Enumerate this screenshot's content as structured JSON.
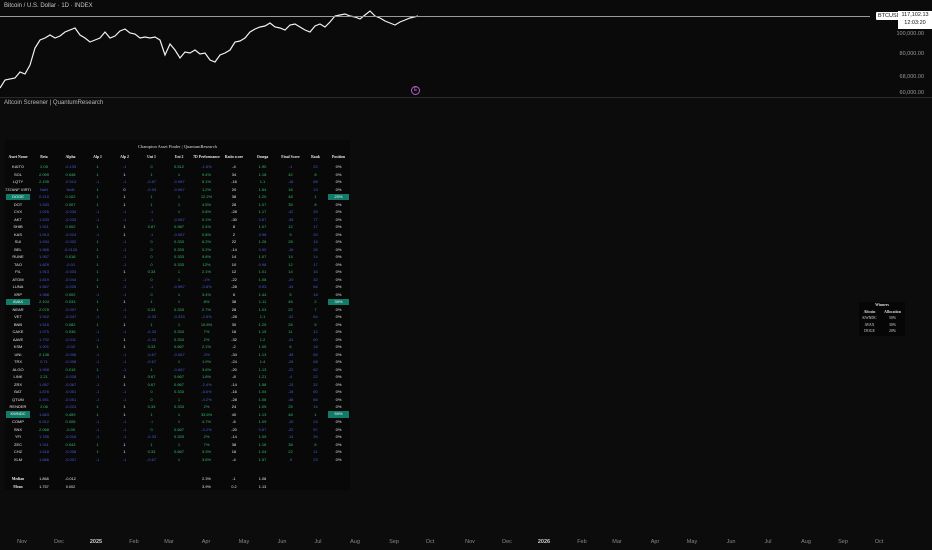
{
  "header": {
    "symbol_title": "Bitcoin / U.S. Dollar · 1D · INDEX"
  },
  "price_axis": {
    "symbol_tag": "BTCUSD",
    "last_price": "117,102.13",
    "countdown": "12:03:20",
    "labels": [
      "100,000.00",
      "80,000.00",
      "68,000.00",
      "60,000.00"
    ]
  },
  "marker": {
    "glyph": "E"
  },
  "indicator": {
    "title": "Altcoin Screener | QuantumResearch"
  },
  "table": {
    "title": "Champion Asset Finder | QuantumResearch",
    "headers": [
      "Asset Name",
      "Beta",
      "Alpha",
      "Alp 1",
      "Alp 2",
      "Uni 1",
      "Uni 2",
      "7D Performance",
      "Ratio score",
      "Omega",
      "Final Score",
      "Rank",
      "Position"
    ],
    "highlight_color": "#137a68",
    "rows": [
      [
        "KAITO",
        "2.08",
        "-0.133",
        "1",
        "-1",
        "0",
        "0.512",
        "-1.6%",
        "-4",
        "1.90",
        "-1",
        "22",
        "0%"
      ],
      [
        "SOL",
        "2.059",
        "0.048",
        "1",
        "1",
        "1",
        "1",
        "9.4%",
        "34",
        "1.18",
        "42",
        "8",
        "0%"
      ],
      [
        "LQTY",
        "2.195",
        "-0.513",
        "-1",
        "-1",
        "-0.87",
        "-0.987",
        "5.1%",
        "-16",
        "1.1",
        "-16",
        "88",
        "0%"
      ],
      [
        "737ANF VIRTU",
        "NaN",
        "NaN",
        "1",
        "0",
        "-0.93",
        "-0.967",
        "1.2%",
        "20",
        "1.64",
        "16",
        "13",
        "0%"
      ],
      [
        "DOGE",
        "0.119",
        "0.102",
        "1",
        "1",
        "1",
        "1",
        "12.2%",
        "38",
        "1.20",
        "48",
        "1",
        "20%"
      ],
      [
        "DOT",
        "1.933",
        "0.007",
        "1",
        "1",
        "1",
        "1",
        "4.5%",
        "28",
        "1.07",
        "35",
        "8",
        "0%"
      ],
      [
        "CVX",
        "1.925",
        "-0.034",
        "-1",
        "-1",
        "-1",
        "1",
        "0.8%",
        "-28",
        "1.17",
        "-42",
        "39",
        "0%"
      ],
      [
        "AKT",
        "1.533",
        "-0.033",
        "-1",
        "-1",
        "-1",
        "-0.987",
        "0.1%",
        "-30",
        "0.87",
        "-38",
        "77",
        "0%"
      ],
      [
        "SHIB",
        "1.511",
        "0.002",
        "1",
        "1",
        "0.87",
        "0.987",
        "2.4%",
        "8",
        "1.07",
        "12",
        "17",
        "0%"
      ],
      [
        "KAS",
        "1.913",
        "-0.024",
        "-1",
        "1",
        "-1",
        "-0.987",
        "0.8%",
        "2",
        "0.98",
        "9",
        "20",
        "0%"
      ],
      [
        "SUI",
        "1.934",
        "-0.002",
        "1",
        "-1",
        "0",
        "0.333",
        "6.2%",
        "22",
        "1.26",
        "28",
        "16",
        "0%"
      ],
      [
        "BEL",
        "1.966",
        "-0.0126",
        "1",
        "-1",
        "0",
        "0.333",
        "0.2%",
        "-14",
        "0.90",
        "-16",
        "26",
        "0%"
      ],
      [
        "RUNE",
        "1.957",
        "0.018",
        "1",
        "-1",
        "0",
        "0.333",
        "9.8%",
        "14",
        "1.07",
        "14",
        "14",
        "0%"
      ],
      [
        "TAO",
        "1.829",
        "-0.01",
        "1",
        "-1",
        "0",
        "0.333",
        "12%",
        "10",
        "0.98",
        "12",
        "17",
        "0%"
      ],
      [
        "FIL",
        "1.913",
        "-0.003",
        "1",
        "1",
        "0.33",
        "1",
        "2.1%",
        "12",
        "1.01",
        "14",
        "16",
        "0%"
      ],
      [
        "ATOM",
        "1.819",
        "-0.044",
        "1",
        "-1",
        "0",
        "1",
        "-1%",
        "-22",
        "1.08",
        "-20",
        "32",
        "0%"
      ],
      [
        "LUNA",
        "1.567",
        "-0.026",
        "1",
        "-1",
        "-1",
        "-0.987",
        "-0.8%",
        "-28",
        "0.93",
        "-34",
        "66",
        "0%"
      ],
      [
        "XRP",
        "1.988",
        "0.002",
        "-1",
        "-1",
        "0",
        "1",
        "3.4%",
        "6",
        "1.44",
        "5",
        "18",
        "0%"
      ],
      [
        "AVAX",
        "2.104",
        "0.033",
        "1",
        "1",
        "1",
        "1",
        "8%",
        "38",
        "1.11",
        "46",
        "2",
        "30%"
      ],
      [
        "NEAR",
        "2.078",
        "-0.007",
        "1",
        "-1",
        "0.33",
        "0.333",
        "2.7%",
        "28",
        "1.03",
        "22",
        "7",
        "0%"
      ],
      [
        "VET",
        "1.942",
        "-0.047",
        "-1",
        "-1",
        "-0.33",
        "-0.333",
        "-2.5%",
        "-28",
        "1.1",
        "-32",
        "84",
        "0%"
      ],
      [
        "BNB",
        "1.516",
        "0.082",
        "1",
        "1",
        "1",
        "1",
        "10.8%",
        "30",
        "1.25",
        "26",
        "5",
        "0%"
      ],
      [
        "CAKE",
        "1.975",
        "0.036",
        "-1",
        "-1",
        "-0.33",
        "0.333",
        "7%",
        "16",
        "1.15",
        "11",
        "12",
        "0%"
      ],
      [
        "AAVE",
        "1.792",
        "-0.011",
        "-1",
        "1",
        "-0.33",
        "0.333",
        "2%",
        "-32",
        "1.2",
        "-34",
        "60",
        "0%"
      ],
      [
        "KSM",
        "1.901",
        "-0.02",
        "1",
        "1",
        "0.33",
        "0.667",
        "2.1%",
        "-2",
        "1.05",
        "6",
        "18",
        "0%"
      ],
      [
        "UNI",
        "2.138",
        "-0.006",
        "-1",
        "-1",
        "-0.67",
        "-0.667",
        "-2%",
        "-34",
        "1.13",
        "-38",
        "65",
        "0%"
      ],
      [
        "TRX",
        "0.71",
        "-0.008",
        "-1",
        "-1",
        "-0.67",
        "1",
        "1.9%",
        "-24",
        "1.4",
        "-28",
        "68",
        "0%"
      ],
      [
        "ALGO",
        "1.998",
        "0.015",
        "1",
        "-1",
        "1",
        "-0.667",
        "3.6%",
        "-20",
        "1.13",
        "-22",
        "62",
        "0%"
      ],
      [
        "LINK",
        "2.21",
        "-0.028",
        "-1",
        "1",
        "0.67",
        "0.667",
        "1.8%",
        "-8",
        "1.21",
        "-4",
        "22",
        "0%"
      ],
      [
        "ZRX",
        "1.957",
        "-0.067",
        "-1",
        "1",
        "0.67",
        "0.667",
        "-2.4%",
        "-14",
        "1.58",
        "-13",
        "32",
        "0%"
      ],
      [
        "BAT",
        "1.876",
        "-0.051",
        "-1",
        "-1",
        "0",
        "0.333",
        "-5.6%",
        "-16",
        "1.04",
        "-18",
        "60",
        "0%"
      ],
      [
        "QTUM",
        "0.451",
        "-0.051",
        "-1",
        "-1",
        "0",
        "1",
        "-4.2%",
        "-28",
        "1.06",
        "-48",
        "66",
        "0%"
      ],
      [
        "RENDER",
        "2.06",
        "-0.024",
        "1",
        "1",
        "0.33",
        "0.333",
        "2%",
        "24",
        "1.05",
        "25",
        "16",
        "0%"
      ],
      [
        "KWNDC",
        "1.663",
        "0.459",
        "1",
        "1",
        "1",
        "1",
        "33.6%",
        "40",
        "1.13",
        "48",
        "1",
        "50%"
      ],
      [
        "COMP",
        "0.912",
        "0.008",
        "-1",
        "-1",
        "-1",
        "1",
        "4.7%",
        "-6",
        "1.09",
        "-10",
        "24",
        "0%"
      ],
      [
        "SNX",
        "2.068",
        "-0.00",
        "-1",
        "-1",
        "0",
        "0.667",
        "-0.2%",
        "-20",
        "0.87",
        "-22",
        "57",
        "0%"
      ],
      [
        "YFI",
        "1.785",
        "-0.016",
        "-1",
        "-1",
        "-0.33",
        "0.333",
        "2%",
        "-14",
        "1.09",
        "-14",
        "39",
        "0%"
      ],
      [
        "ZEC",
        "1.911",
        "0.043",
        "1",
        "1",
        "1",
        "1",
        "7%",
        "38",
        "1.16",
        "38",
        "6",
        "0%"
      ],
      [
        "CHZ",
        "1.518",
        "-0.008",
        "1",
        "1",
        "0.33",
        "0.667",
        "3.3%",
        "16",
        "1.04",
        "22",
        "11",
        "0%"
      ],
      [
        "XLM",
        "1.866",
        "-0.007",
        "-1",
        "-1",
        "-0.67",
        "1",
        "3.6%",
        "-4",
        "1.57",
        "-9",
        "23",
        "0%"
      ]
    ],
    "summary": [
      [
        "Median",
        "1.868",
        "-0.012",
        "",
        "",
        "",
        "",
        "2.3%",
        "-1",
        "1.08",
        "",
        "",
        ""
      ],
      [
        "Mean",
        "1.757",
        "0.002",
        "",
        "",
        "",
        "",
        "3.9%",
        "0.2",
        "1.13",
        "",
        "",
        ""
      ]
    ]
  },
  "winners": {
    "title": "Winners",
    "headers": [
      "Altcoin",
      "Allocation"
    ],
    "rows": [
      [
        "KWNDC",
        "50%"
      ],
      [
        "AVAX",
        "30%"
      ],
      [
        "DOGE",
        "20%"
      ]
    ]
  },
  "time_axis": [
    "Nov",
    "Dec",
    "2025",
    "Feb",
    "Mar",
    "Apr",
    "May",
    "Jun",
    "Jul",
    "Aug",
    "Sep",
    "Oct",
    "Nov",
    "Dec",
    "2026",
    "Feb",
    "Mar",
    "Apr",
    "May",
    "Jun",
    "Jul",
    "Aug",
    "Sep",
    "Oct"
  ]
}
